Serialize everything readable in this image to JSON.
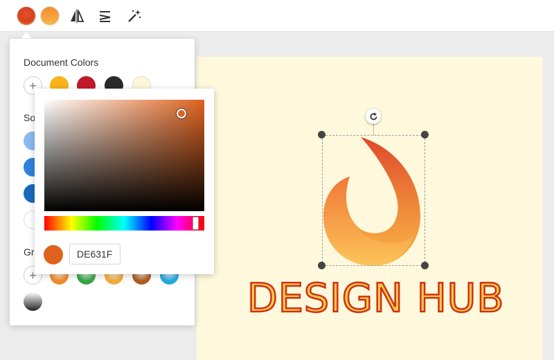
{
  "toolbar": {
    "fill_swatch_icon": "gradient-fill-swatch",
    "stroke_swatch_icon": "gradient-stroke-swatch",
    "flip_icon": "flip-horizontal-icon",
    "align_icon": "align-icon",
    "magic_icon": "magic-wand-icon"
  },
  "color_panel": {
    "title": "Document Colors",
    "document_colors": [
      "#f8b41a",
      "#c01a2a",
      "#2a2a2a",
      "#fdf6da"
    ],
    "solid_label": "So",
    "solid_colors": [
      "#8cb9ec",
      "#2d83dd",
      "#1a68c0",
      "#ffffff"
    ],
    "gradient_label": "Gra",
    "gradient_colors": [
      "#ee8a2c",
      "#34a544",
      "#f3a93a",
      "#b05a20",
      "#22a8dd"
    ],
    "gradient_extra": "#222222"
  },
  "picker": {
    "hex_value": "DE631F",
    "preview_color": "#de631f",
    "hue_color": "#de631f"
  },
  "canvas": {
    "background": "#fef8dc",
    "wordmark": "DESIGN HUB",
    "wordmark_fill": "#fdcf40",
    "wordmark_stroke": "#cf2f1c"
  }
}
